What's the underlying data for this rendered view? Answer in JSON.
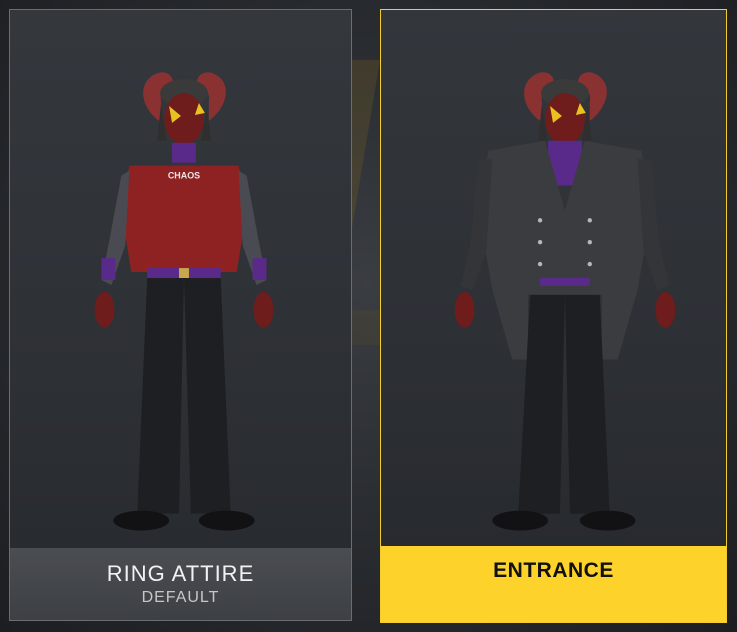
{
  "attire_options": [
    {
      "title": "RING ATTIRE",
      "subtitle": "DEFAULT",
      "selected": false,
      "shirt_text": "CHAOS"
    },
    {
      "title": "ENTRANCE",
      "subtitle": "",
      "selected": true
    }
  ],
  "colors": {
    "accent": "#fdd22a",
    "skin": "#7e2020",
    "purple": "#5a2a8a",
    "horn": "#8a3232"
  }
}
